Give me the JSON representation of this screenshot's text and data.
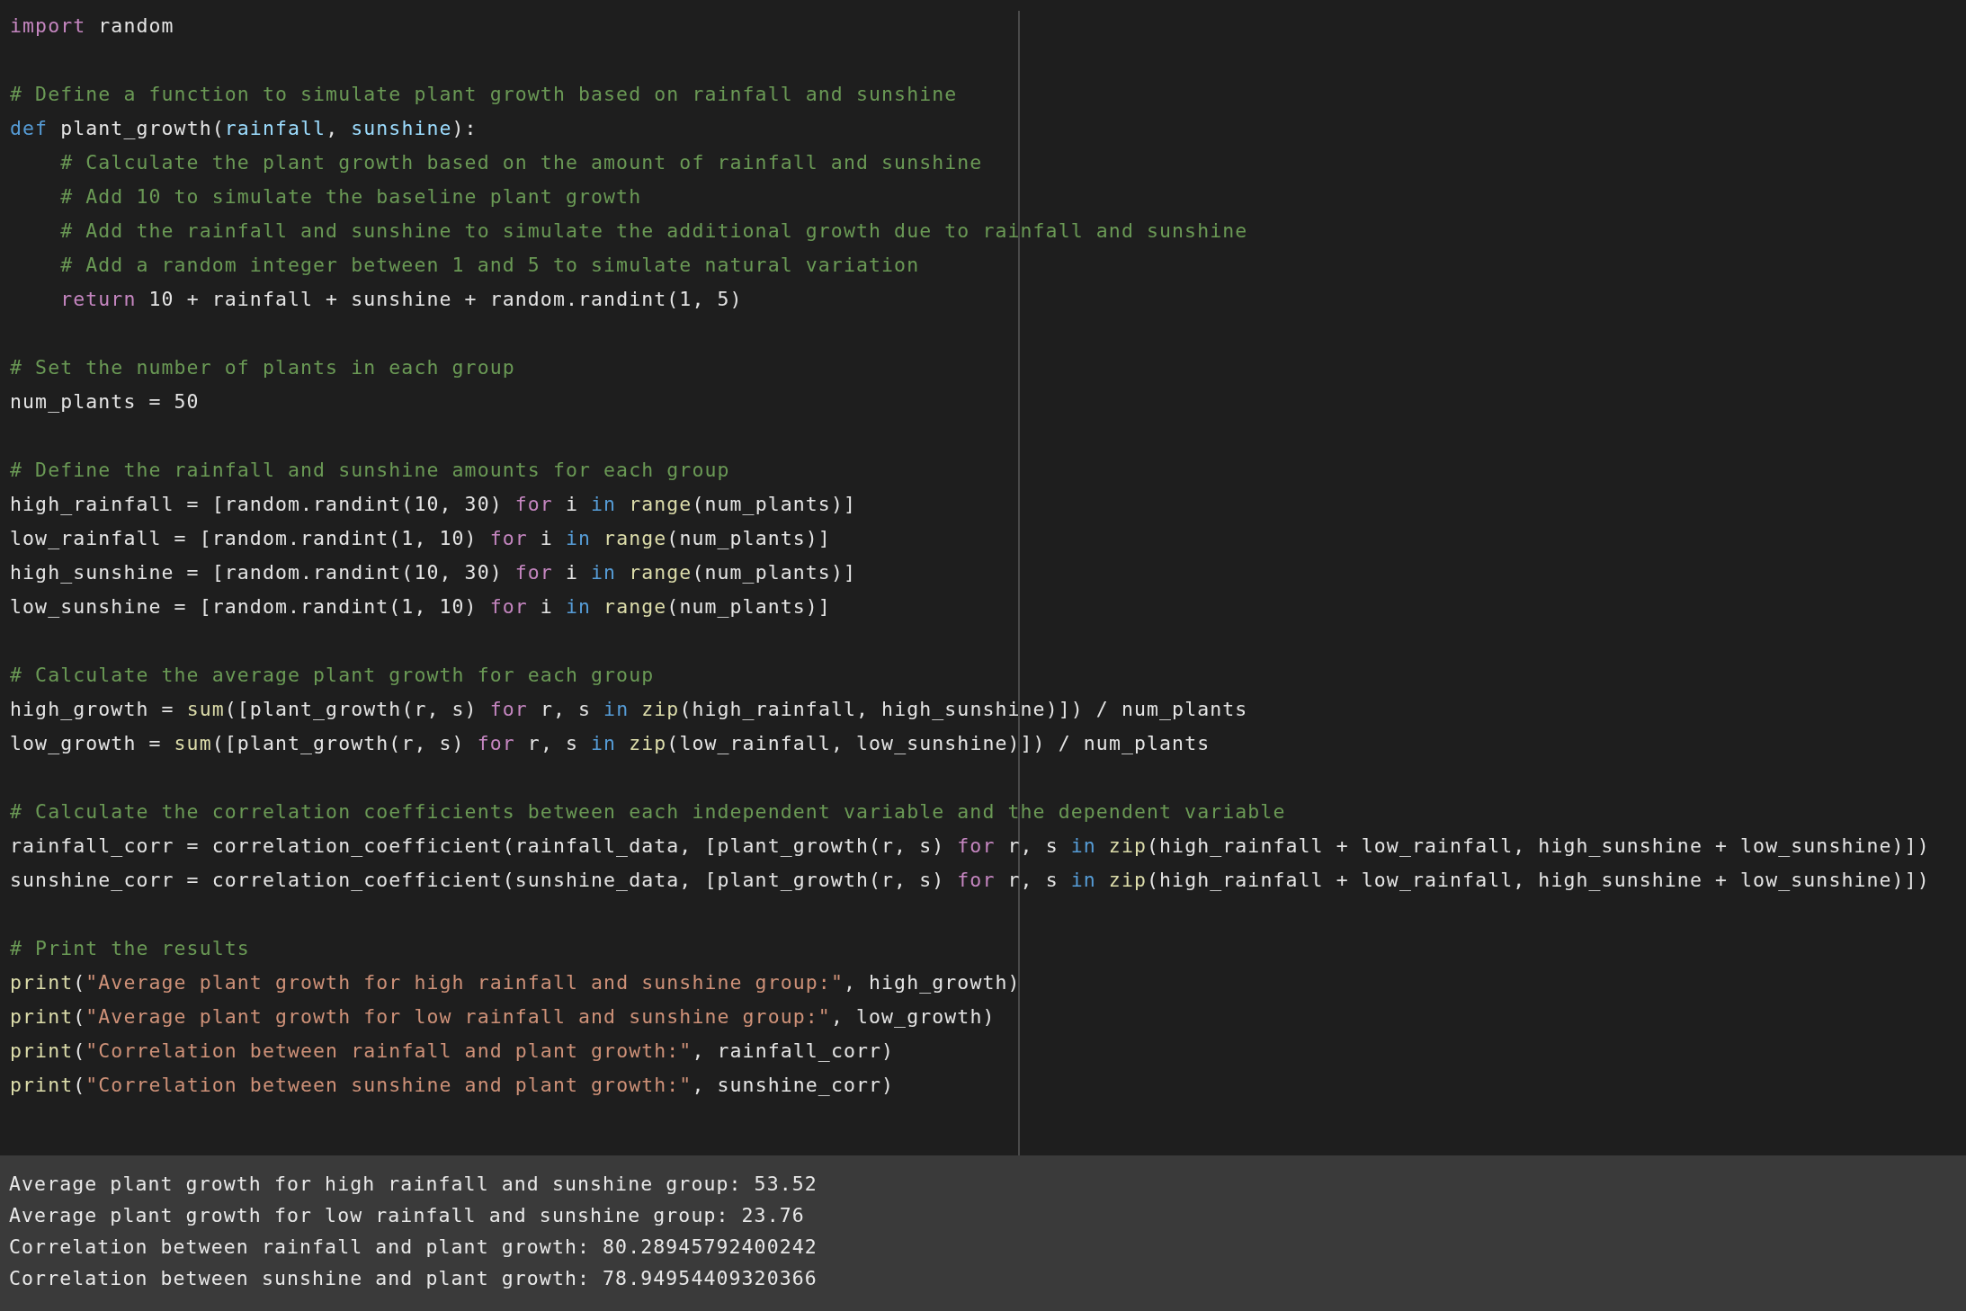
{
  "editor": {
    "blocks": [
      {
        "lines": [
          [
            {
              "text": "import",
              "kind": "keyword"
            },
            {
              "text": " random",
              "kind": "plain"
            }
          ]
        ]
      },
      {
        "lines": [
          [
            {
              "text": "# Define a function to simulate plant growth based on rainfall and sunshine",
              "kind": "comment"
            }
          ],
          [
            {
              "text": "def",
              "kind": "storage"
            },
            {
              "text": " plant_growth(",
              "kind": "plain"
            },
            {
              "text": "rainfall",
              "kind": "param"
            },
            {
              "text": ", ",
              "kind": "plain"
            },
            {
              "text": "sunshine",
              "kind": "param"
            },
            {
              "text": "):",
              "kind": "plain"
            }
          ],
          [
            {
              "text": "    # Calculate the plant growth based on the amount of rainfall and sunshine",
              "kind": "comment"
            }
          ],
          [
            {
              "text": "    # Add 10 to simulate the baseline plant growth",
              "kind": "comment"
            }
          ],
          [
            {
              "text": "    # Add the rainfall and sunshine to simulate the additional growth due to rainfall and sunshine",
              "kind": "comment"
            }
          ],
          [
            {
              "text": "    # Add a random integer between 1 and 5 to simulate natural variation",
              "kind": "comment"
            }
          ],
          [
            {
              "text": "    return",
              "kind": "keyword"
            },
            {
              "text": " 10 + rainfall + sunshine + random.randint(1, 5)",
              "kind": "plain"
            }
          ]
        ]
      },
      {
        "lines": [
          [
            {
              "text": "# Set the number of plants in each group",
              "kind": "comment"
            }
          ],
          [
            {
              "text": "num_plants = 50",
              "kind": "plain"
            }
          ]
        ]
      },
      {
        "lines": [
          [
            {
              "text": "# Define the rainfall and sunshine amounts for each group",
              "kind": "comment"
            }
          ],
          [
            {
              "text": "high_rainfall = [random.randint(10, 30) ",
              "kind": "plain"
            },
            {
              "text": "for",
              "kind": "keyword"
            },
            {
              "text": " i ",
              "kind": "plain"
            },
            {
              "text": "in ",
              "kind": "storage"
            },
            {
              "text": "range",
              "kind": "builtin"
            },
            {
              "text": "(num_plants)]",
              "kind": "plain"
            }
          ],
          [
            {
              "text": "low_rainfall = [random.randint(1, 10) ",
              "kind": "plain"
            },
            {
              "text": "for",
              "kind": "keyword"
            },
            {
              "text": " i ",
              "kind": "plain"
            },
            {
              "text": "in ",
              "kind": "storage"
            },
            {
              "text": "range",
              "kind": "builtin"
            },
            {
              "text": "(num_plants)]",
              "kind": "plain"
            }
          ],
          [
            {
              "text": "high_sunshine = [random.randint(10, 30) ",
              "kind": "plain"
            },
            {
              "text": "for",
              "kind": "keyword"
            },
            {
              "text": " i ",
              "kind": "plain"
            },
            {
              "text": "in ",
              "kind": "storage"
            },
            {
              "text": "range",
              "kind": "builtin"
            },
            {
              "text": "(num_plants)]",
              "kind": "plain"
            }
          ],
          [
            {
              "text": "low_sunshine = [random.randint(1, 10) ",
              "kind": "plain"
            },
            {
              "text": "for",
              "kind": "keyword"
            },
            {
              "text": " i ",
              "kind": "plain"
            },
            {
              "text": "in ",
              "kind": "storage"
            },
            {
              "text": "range",
              "kind": "builtin"
            },
            {
              "text": "(num_plants)]",
              "kind": "plain"
            }
          ]
        ]
      },
      {
        "lines": [
          [
            {
              "text": "# Calculate the average plant growth for each group",
              "kind": "comment"
            }
          ],
          [
            {
              "text": "high_growth = ",
              "kind": "plain"
            },
            {
              "text": "sum",
              "kind": "builtin"
            },
            {
              "text": "([plant_growth(r, s) ",
              "kind": "plain"
            },
            {
              "text": "for",
              "kind": "keyword"
            },
            {
              "text": " r, s ",
              "kind": "plain"
            },
            {
              "text": "in ",
              "kind": "storage"
            },
            {
              "text": "zip",
              "kind": "builtin"
            },
            {
              "text": "(high_rainfall, high_sunshine)]) / num_plants",
              "kind": "plain"
            }
          ],
          [
            {
              "text": "low_growth = ",
              "kind": "plain"
            },
            {
              "text": "sum",
              "kind": "builtin"
            },
            {
              "text": "([plant_growth(r, s) ",
              "kind": "plain"
            },
            {
              "text": "for",
              "kind": "keyword"
            },
            {
              "text": " r, s ",
              "kind": "plain"
            },
            {
              "text": "in ",
              "kind": "storage"
            },
            {
              "text": "zip",
              "kind": "builtin"
            },
            {
              "text": "(low_rainfall, low_sunshine)]) / num_plants",
              "kind": "plain"
            }
          ]
        ]
      },
      {
        "lines": [
          [
            {
              "text": "# Calculate the correlation coefficients between each independent variable and the dependent variable",
              "kind": "comment"
            }
          ],
          [
            {
              "text": "rainfall_corr = correlation_coefficient(rainfall_data, [plant_growth(r, s) ",
              "kind": "plain"
            },
            {
              "text": "for",
              "kind": "keyword"
            },
            {
              "text": " r, s ",
              "kind": "plain"
            },
            {
              "text": "in ",
              "kind": "storage"
            },
            {
              "text": "zip",
              "kind": "builtin"
            },
            {
              "text": "(high_rainfall + low_rainfall, high_sunshine + low_sunshine)])",
              "kind": "plain"
            }
          ],
          [
            {
              "text": "sunshine_corr = correlation_coefficient(sunshine_data, [plant_growth(r, s) ",
              "kind": "plain"
            },
            {
              "text": "for",
              "kind": "keyword"
            },
            {
              "text": " r, s ",
              "kind": "plain"
            },
            {
              "text": "in ",
              "kind": "storage"
            },
            {
              "text": "zip",
              "kind": "builtin"
            },
            {
              "text": "(high_rainfall + low_rainfall, high_sunshine + low_sunshine)])",
              "kind": "plain"
            }
          ]
        ]
      },
      {
        "lines": [
          [
            {
              "text": "# Print the results",
              "kind": "comment"
            }
          ],
          [
            {
              "text": "print",
              "kind": "builtin"
            },
            {
              "text": "(",
              "kind": "plain"
            },
            {
              "text": "\"Average plant growth for high rainfall and sunshine group:\"",
              "kind": "string"
            },
            {
              "text": ", high_growth)",
              "kind": "plain"
            }
          ],
          [
            {
              "text": "print",
              "kind": "builtin"
            },
            {
              "text": "(",
              "kind": "plain"
            },
            {
              "text": "\"Average plant growth for low rainfall and sunshine group:\"",
              "kind": "string"
            },
            {
              "text": ", low_growth)",
              "kind": "plain"
            }
          ],
          [
            {
              "text": "print",
              "kind": "builtin"
            },
            {
              "text": "(",
              "kind": "plain"
            },
            {
              "text": "\"Correlation between rainfall and plant growth:\"",
              "kind": "string"
            },
            {
              "text": ", rainfall_corr)",
              "kind": "plain"
            }
          ],
          [
            {
              "text": "print",
              "kind": "builtin"
            },
            {
              "text": "(",
              "kind": "plain"
            },
            {
              "text": "\"Correlation between sunshine and plant growth:\"",
              "kind": "string"
            },
            {
              "text": ", sunshine_corr)",
              "kind": "plain"
            }
          ]
        ]
      }
    ]
  },
  "output": {
    "lines": [
      "Average plant growth for high rainfall and sunshine group: 53.52",
      "Average plant growth for low rainfall and sunshine group: 23.76",
      "Correlation between rainfall and plant growth: 80.28945792400242",
      "Correlation between sunshine and plant growth: 78.94954409320366"
    ]
  }
}
